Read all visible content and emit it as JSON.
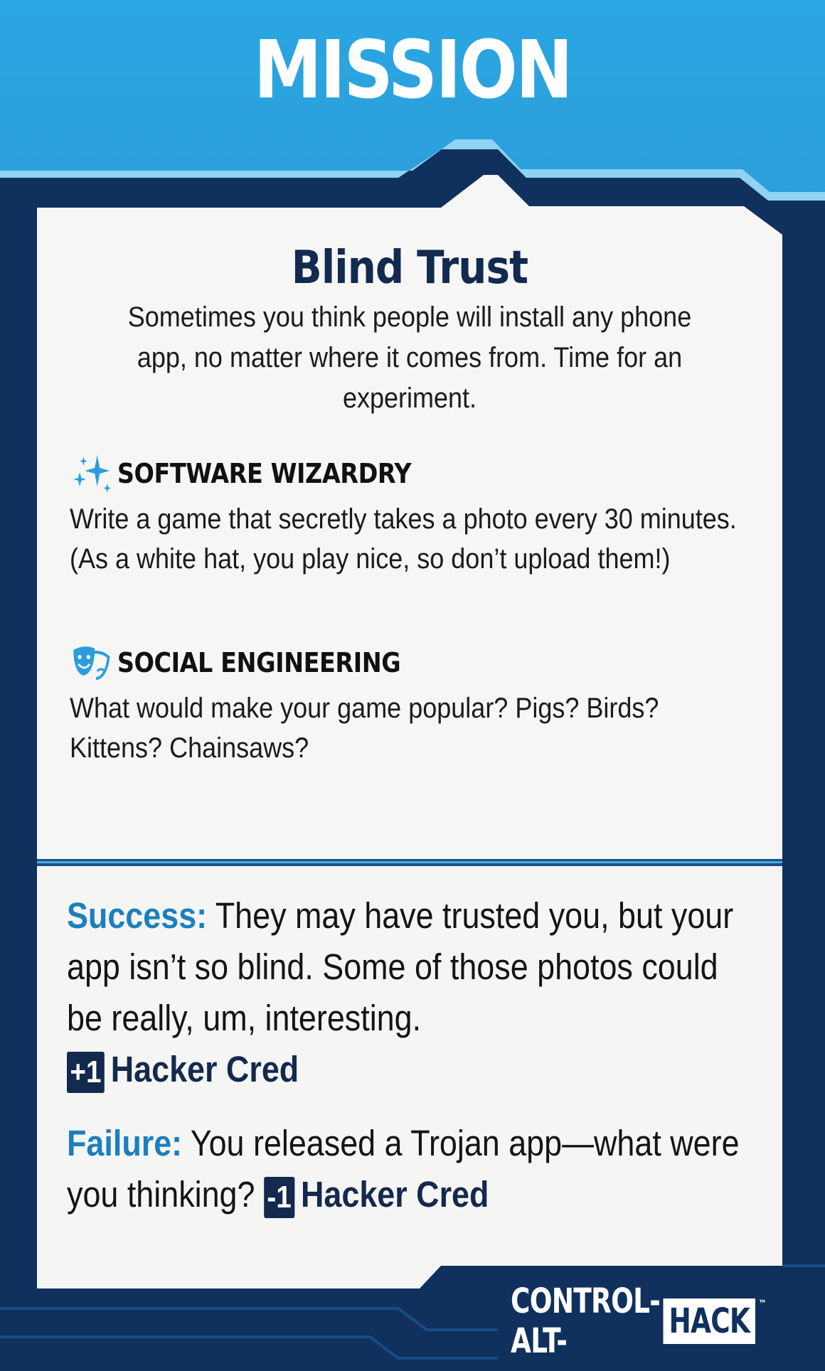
{
  "card": {
    "type": "MISSION",
    "name": "Blind Trust",
    "intro": "Sometimes you think people will install any phone app, no matter where it comes from. Time for an experiment."
  },
  "skills": [
    {
      "name": "SOFTWARE WIZARDRY",
      "icon": "sparkles-icon",
      "text": "Write a game that secretly takes a photo every 30 minutes. (As a white hat, you play nice, so don’t upload them!)"
    },
    {
      "name": "SOCIAL ENGINEERING",
      "icon": "theater-masks-icon",
      "text": "What would make your game popular? Pigs? Birds? Kittens? Chainsaws?"
    }
  ],
  "success": {
    "label": "Success:",
    "text": "They may have trusted you, but your app isn’t so blind. Some of those photos could be really, um, interesting.",
    "badge": "+1",
    "cred": "Hacker Cred"
  },
  "failure": {
    "label": "Failure:",
    "text": "You released a Trojan app—what were you thinking?",
    "badge": "-1",
    "cred": "Hacker Cred"
  },
  "logo": {
    "left": "CONTROL-ALT-",
    "right": "HACK",
    "tm": "™"
  },
  "colors": {
    "header_blue": "#29a3e0",
    "frame_navy": "#10305e",
    "label_blue": "#1b7fbf",
    "panel": "#f6f6f4"
  }
}
